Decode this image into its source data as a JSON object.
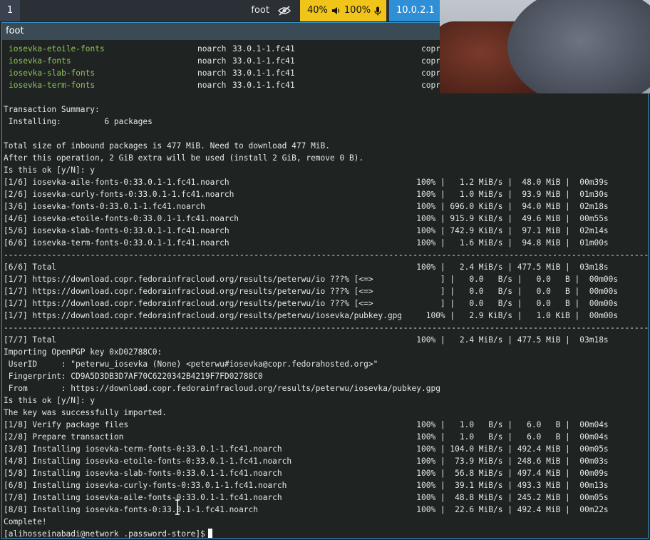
{
  "bar": {
    "workspace": "1",
    "focused_app": "foot",
    "audio": {
      "volume": "40%",
      "mic": "100%"
    },
    "network": "10.0.2.1",
    "colors": {
      "audio_bg": "#f0c419",
      "network_bg": "#2f8fd6"
    }
  },
  "window": {
    "title": "foot"
  },
  "terminal": {
    "packages": [
      {
        "name": "iosevka-etoile-fonts",
        "arch": "noarch",
        "version": "33.0.1-1.fc41",
        "repo": "copr"
      },
      {
        "name": "iosevka-fonts",
        "arch": "noarch",
        "version": "33.0.1-1.fc41",
        "repo": "copr"
      },
      {
        "name": "iosevka-slab-fonts",
        "arch": "noarch",
        "version": "33.0.1-1.fc41",
        "repo": "copr"
      },
      {
        "name": "iosevka-term-fonts",
        "arch": "noarch",
        "version": "33.0.1-1.fc41",
        "repo": "copr"
      }
    ],
    "lines": [
      "",
      "Transaction Summary:",
      " Installing:         6 packages",
      "",
      "Total size of inbound packages is 477 MiB. Need to download 477 MiB.",
      "After this operation, 2 GiB extra will be used (install 2 GiB, remove 0 B).",
      "Is this ok [y/N]: y",
      "[1/6] iosevka-aile-fonts-0:33.0.1-1.fc41.noarch                                       100% |   1.2 MiB/s |  48.0 MiB |  00m39s",
      "[2/6] iosevka-curly-fonts-0:33.0.1-1.fc41.noarch                                      100% |   1.0 MiB/s |  93.9 MiB |  01m30s",
      "[3/6] iosevka-fonts-0:33.0.1-1.fc41.noarch                                            100% | 696.0 KiB/s |  94.0 MiB |  02m18s",
      "[4/6] iosevka-etoile-fonts-0:33.0.1-1.fc41.noarch                                     100% | 915.9 KiB/s |  49.6 MiB |  00m55s",
      "[5/6] iosevka-slab-fonts-0:33.0.1-1.fc41.noarch                                       100% | 742.9 KiB/s |  97.1 MiB |  02m14s",
      "[6/6] iosevka-term-fonts-0:33.0.1-1.fc41.noarch                                       100% |   1.6 MiB/s |  94.8 MiB |  01m00s",
      "-----------------------------------------------------------------------------------------------------------------------------------------",
      "[6/6] Total                                                                           100% |   2.4 MiB/s | 477.5 MiB |  03m18s",
      "[1/7] https://download.copr.fedorainfracloud.org/results/peterwu/io ???% [<=>              ] |   0.0   B/s |   0.0   B |  00m00s",
      "[1/7] https://download.copr.fedorainfracloud.org/results/peterwu/io ???% [<=>              ] |   0.0   B/s |   0.0   B |  00m00s",
      "[1/7] https://download.copr.fedorainfracloud.org/results/peterwu/io ???% [<=>              ] |   0.0   B/s |   0.0   B |  00m00s",
      "[1/7] https://download.copr.fedorainfracloud.org/results/peterwu/iosevka/pubkey.gpg     100% |   2.9 KiB/s |   1.0 KiB |  00m00s",
      "-----------------------------------------------------------------------------------------------------------------------------------------",
      "[7/7] Total                                                                           100% |   2.4 MiB/s | 477.5 MiB |  03m18s",
      "Importing OpenPGP key 0xD02788C0:",
      " UserID     : \"peterwu_iosevka (None) <peterwu#iosevka@copr.fedorahosted.org>\"",
      " Fingerprint: CD9A5D3DB3D7AF70C6220342B4219F7FD02788C0",
      " From       : https://download.copr.fedorainfracloud.org/results/peterwu/iosevka/pubkey.gpg",
      "Is this ok [y/N]: y",
      "The key was successfully imported.",
      "[1/8] Verify package files                                                            100% |   1.0   B/s |   6.0   B |  00m04s",
      "[2/8] Prepare transaction                                                             100% |   1.0   B/s |   6.0   B |  00m04s",
      "[3/8] Installing iosevka-term-fonts-0:33.0.1-1.fc41.noarch                            100% | 104.0 MiB/s | 492.4 MiB |  00m05s",
      "[4/8] Installing iosevka-etoile-fonts-0:33.0.1-1.fc41.noarch                          100% |  73.9 MiB/s | 248.6 MiB |  00m03s",
      "[5/8] Installing iosevka-slab-fonts-0:33.0.1-1.fc41.noarch                            100% |  56.8 MiB/s | 497.4 MiB |  00m09s",
      "[6/8] Installing iosevka-curly-fonts-0:33.0.1-1.fc41.noarch                           100% |  39.1 MiB/s | 493.3 MiB |  00m13s",
      "[7/8] Installing iosevka-aile-fonts-0:33.0.1-1.fc41.noarch                            100% |  48.8 MiB/s | 245.2 MiB |  00m05s",
      "[8/8] Installing iosevka-fonts-0:33.0.1-1.fc41.noarch                                 100% |  22.6 MiB/s | 492.4 MiB |  00m22s",
      "Complete!"
    ],
    "prompt": "[alihosseinabadi@network .password-store]$"
  }
}
